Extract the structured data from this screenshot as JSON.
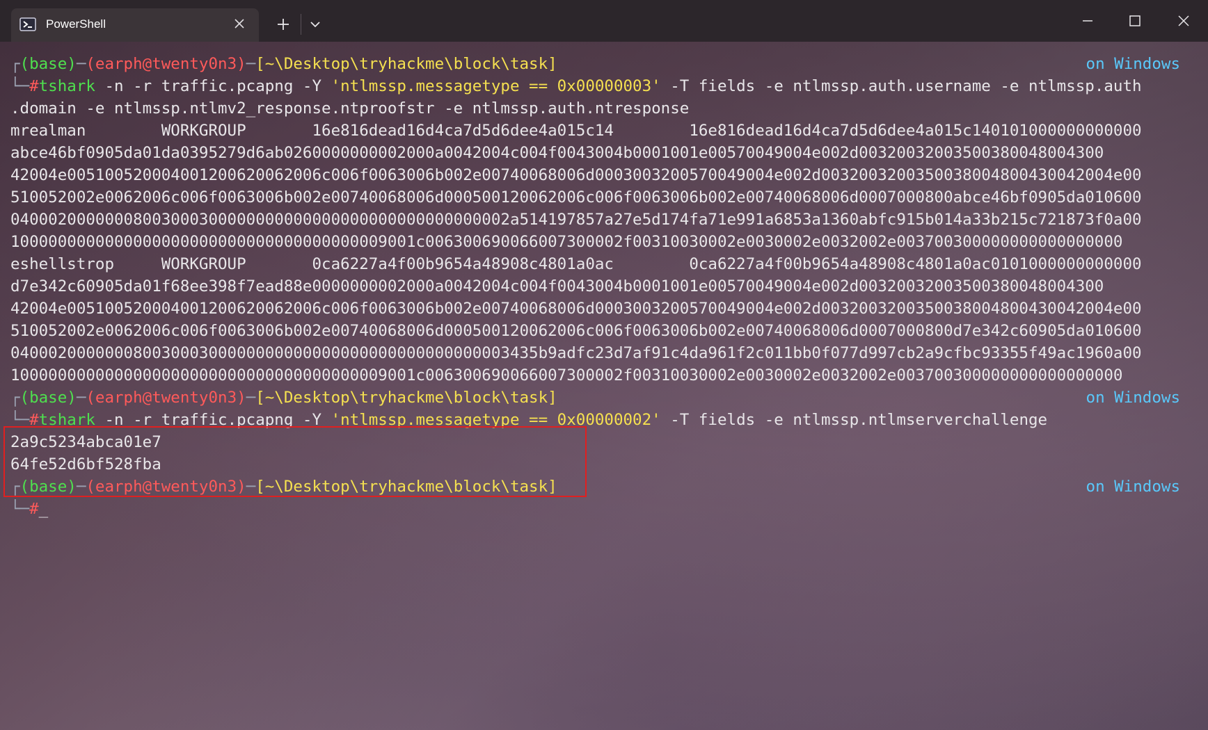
{
  "window": {
    "tab_title": "PowerShell",
    "tab_icon": "powershell-icon",
    "newtab_icon": "plus-icon",
    "dropdown_icon": "chevron-down-icon",
    "minimize_icon": "minimize-icon",
    "maximize_icon": "maximize-icon",
    "close_icon": "close-icon"
  },
  "prompt": {
    "box_top": "┌",
    "box_bottom": "└─",
    "base": "(base)",
    "dash": "─",
    "user_host": "(earph@twenty0n3)",
    "path": "[~\\Desktop\\tryhackme\\block\\task]",
    "right_label": "on Windows",
    "hash": "#"
  },
  "commands": [
    {
      "tool": "tshark",
      "args_before": " -n -r traffic.pcapng -Y ",
      "filter": "'ntlmssp.messagetype == 0x00000003'",
      "args_after": " -T fields -e ntlmssp.auth.username -e ntlmssp.auth",
      "continuation": ".domain -e ntlmssp.ntlmv2_response.ntproofstr -e ntlmssp.auth.ntresponse"
    },
    {
      "tool": "tshark",
      "args_before": " -n -r traffic.pcapng -Y ",
      "filter": "'ntlmssp.messagetype == 0x00000002'",
      "args_after": " -T fields -e ntlmssp.ntlmserverchallenge"
    }
  ],
  "output1": [
    "mrealman        WORKGROUP       16e816dead16d4ca7d5d6dee4a015c14        16e816dead16d4ca7d5d6dee4a015c140101000000000000",
    "abce46bf0905da01da0395279d6ab0260000000002000a0042004c004f0043004b0001001e00570049004e002d00320032003500380048004300",
    "42004e005100520004001200620062006c006f0063006b002e00740068006d0003003200570049004e002d0032003200350038004800430042004e00",
    "510052002e0062006c006f0063006b002e00740068006d000500120062006c006f0063006b002e00740068006d0007000800abce46bf0905da010600",
    "04000200000008003000300000000000000000000000000000002a514197857a27e5d174fa71e991a6853a1360abfc915b014a33b215c721873f0a00",
    "1000000000000000000000000000000000000009001c006300690066007300002f00310030002e0030002e0032002e003700300000000000000000"
  ],
  "output2": [
    "eshellstrop     WORKGROUP       0ca6227a4f00b9654a48908c4801a0ac        0ca6227a4f00b9654a48908c4801a0ac0101000000000000",
    "d7e342c60905da01f68ee398f7ead88e0000000002000a0042004c004f0043004b0001001e00570049004e002d00320032003500380048004300",
    "42004e005100520004001200620062006c006f0063006b002e00740068006d0003003200570049004e002d0032003200350038004800430042004e00",
    "510052002e0062006c006f0063006b002e00740068006d000500120062006c006f0063006b002e00740068006d0007000800d7e342c60905da010600",
    "04000200000008003000300000000000000000000000000000003435b9adfc23d7af91c4da961f2c011bb0f077d997cb2a9cfbc93355f49ac1960a00",
    "1000000000000000000000000000000000000009001c006300690066007300002f00310030002e0030002e0032002e003700300000000000000000"
  ],
  "output3": [
    "2a9c5234abca01e7",
    "64fe52d6bf528fba"
  ],
  "cursor": "_"
}
